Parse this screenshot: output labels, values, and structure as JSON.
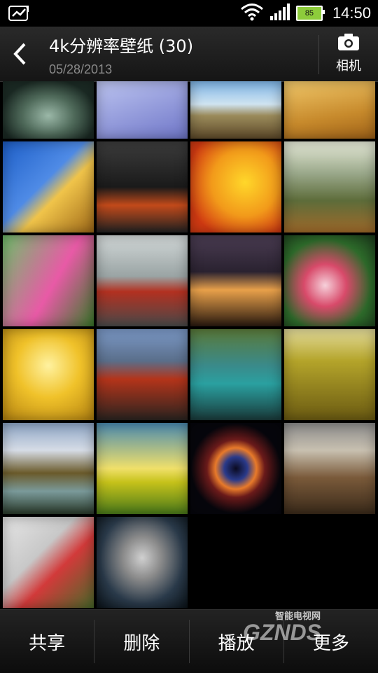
{
  "status_bar": {
    "battery": "85",
    "time": "14:50"
  },
  "header": {
    "title": "4k分辨率壁纸 (30)",
    "date": "05/28/2013",
    "camera_label": "相机"
  },
  "tiles": [
    {
      "name": "tile-glass-globe",
      "bg": "radial-gradient(ellipse at 50% 60%, #9bb8a8 0%, #4f6a5a 40%, #1b2a24 75%)"
    },
    {
      "name": "tile-android-robot",
      "bg": "linear-gradient(160deg,#bcc4f0,#6f76c8)"
    },
    {
      "name": "tile-tree-savanna",
      "bg": "linear-gradient(#7fb6e8 0%, #cfe3f0 40%, #9a8a5a 60%, #5e4a2a 100%)"
    },
    {
      "name": "tile-sand-dunes",
      "bg": "linear-gradient(170deg,#f1c86a,#c78a2c 60%,#a06218)"
    },
    {
      "name": "tile-blossom-branch",
      "bg": "linear-gradient(135deg,#1e5fc8 0%,#4f8be6 45%,#f0c44a 60%,#a06a18 100%)"
    },
    {
      "name": "tile-sports-car-dark",
      "bg": "linear-gradient(#3c3c3c,#1a1a1a 50%,#c24a1a 70%,#222)"
    },
    {
      "name": "tile-yellow-flowers",
      "bg": "radial-gradient(circle at 60% 45%, #ffd72a 0%, #f29a1a 45%, #d23a12 80%)"
    },
    {
      "name": "tile-misty-forest",
      "bg": "linear-gradient(#e6ead8 0%,#9aa88a 35%,#5d6c3a 65%,#a06a2a 100%)"
    },
    {
      "name": "tile-tulips",
      "bg": "linear-gradient(120deg,#6fbf6a,#e85aa6 55%,#3a7a2a)"
    },
    {
      "name": "tile-red-car-road",
      "bg": "linear-gradient(#d2d8d8 0%,#9aa4a4 45%,#b23020 62%,#4a4a4a 100%)"
    },
    {
      "name": "tile-city-bridge",
      "bg": "linear-gradient(#4a3c52 0%,#2a2230 40%,#e8a04a 60%,#2a1a10 100%)"
    },
    {
      "name": "tile-pink-flowers",
      "bg": "radial-gradient(circle at 45% 55%, #f6d0da 0%, #d84a6a 30%, #2d6a2a 65%, #1c3a1c 100%)"
    },
    {
      "name": "tile-golden-dandelion",
      "bg": "radial-gradient(circle at 50% 40%, #fff2a0 0%, #f0c22a 45%, #b48210 100%)"
    },
    {
      "name": "tile-city-street",
      "bg": "linear-gradient(#7c9ac8 0%,#5a6e8a 35%,#b4341a 55%,#2a2420 100%)"
    },
    {
      "name": "tile-river-rapids",
      "bg": "linear-gradient(#5a7a3a 0%,#3a8a8a 40%,#2aa0a0 60%,#1a3a3a 100%)"
    },
    {
      "name": "tile-farm-field",
      "bg": "linear-gradient(#e4dc9a 0%,#b4a42a 35%,#6a5a12 100%)"
    },
    {
      "name": "tile-mountain-lake",
      "bg": "linear-gradient(#8ea6c6 0%,#d6dce6 30%,#6a5a2a 55%,#7a9a9a 75%,#2a3a2a 100%)"
    },
    {
      "name": "tile-sunset-sky",
      "bg": "linear-gradient(#4a8ab0 0%,#f0e06a 50%,#c6c21a 65%,#4a7a1a 100%)"
    },
    {
      "name": "tile-helix-nebula",
      "bg": "radial-gradient(circle at 50% 50%, #0a0a20 0%, #2a3a8a 18%, #e87a2a 32%, #6a1a1a 45%, #06060c 70%)"
    },
    {
      "name": "tile-colosseum",
      "bg": "linear-gradient(#8c8c8c 0%,#c8c0b0 30%,#7a5a3a 60%,#3a2a1a 100%)"
    },
    {
      "name": "tile-butterfly-flowers",
      "bg": "linear-gradient(135deg,#e6e6e6 0%,#c8c8c8 40%,#d23a3a 60%,#4a6a2a 100%)"
    },
    {
      "name": "tile-microphone",
      "bg": "radial-gradient(ellipse at 50% 45%, #d0d0d0 0%, #8a8a8a 30%, #2a3a4a 65%, #0a1218 100%)"
    }
  ],
  "bottom_bar": {
    "share": "共享",
    "delete": "删除",
    "play": "播放",
    "more": "更多"
  },
  "watermark": {
    "brand": "GZNDS",
    "sub": "智能电视网"
  }
}
